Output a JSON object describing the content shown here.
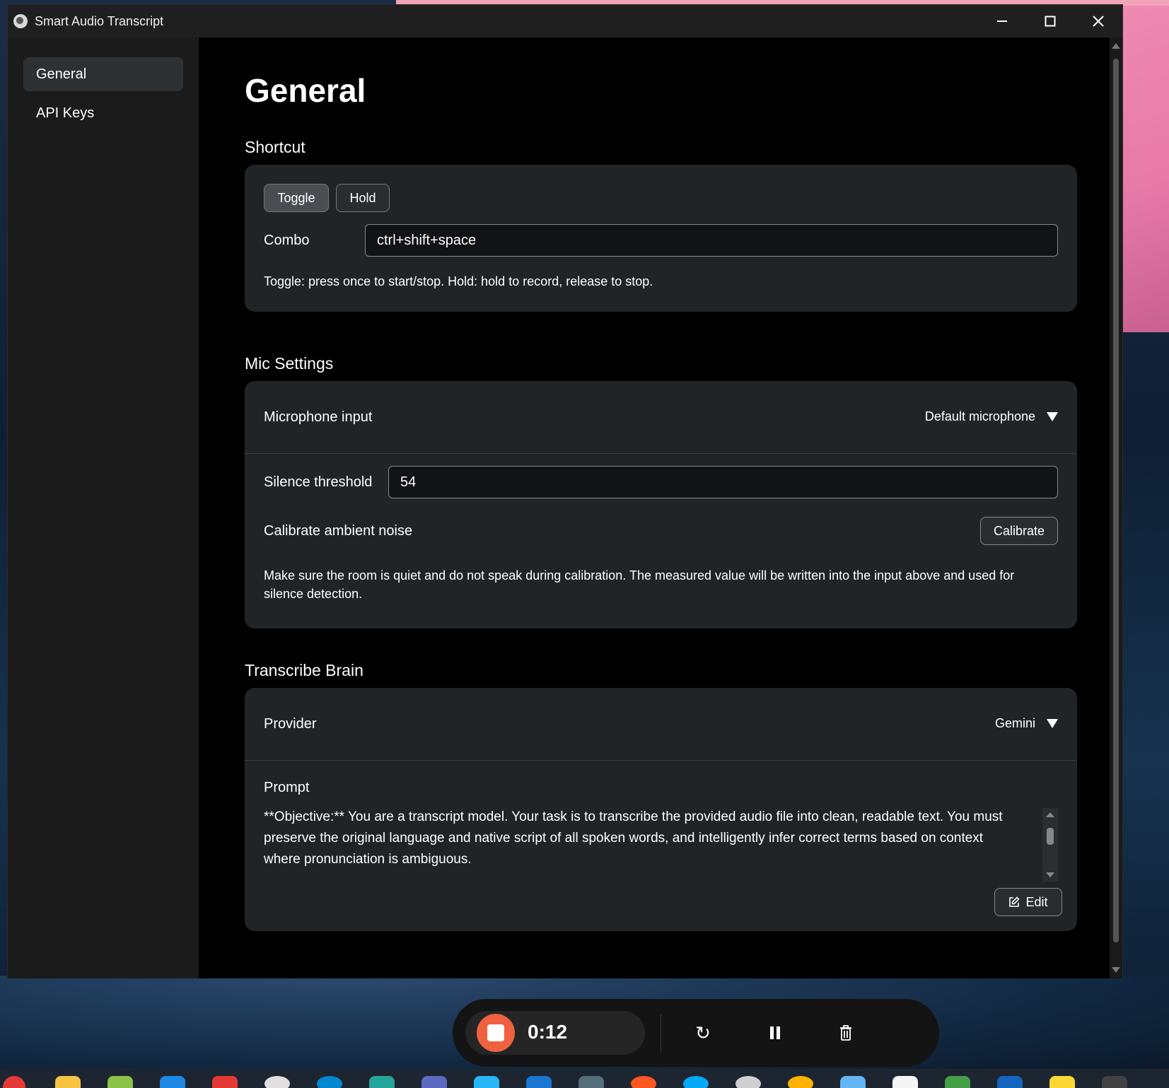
{
  "window": {
    "title": "Smart Audio Transcript"
  },
  "sidebar": {
    "items": [
      {
        "label": "General",
        "active": true
      },
      {
        "label": "API Keys",
        "active": false
      }
    ]
  },
  "page": {
    "title": "General"
  },
  "shortcut": {
    "section_title": "Shortcut",
    "modes": [
      "Toggle",
      "Hold"
    ],
    "selected_mode": "Toggle",
    "combo_label": "Combo",
    "combo_value": "ctrl+shift+space",
    "help": "Toggle: press once to start/stop. Hold: hold to record, release to stop."
  },
  "mic": {
    "section_title": "Mic Settings",
    "input_label": "Microphone input",
    "input_value": "Default microphone",
    "threshold_label": "Silence threshold",
    "threshold_value": "54",
    "calibrate_label": "Calibrate ambient noise",
    "calibrate_button": "Calibrate",
    "help": "Make sure the room is quiet and do not speak during calibration. The measured value will be written into the input above and used for silence detection."
  },
  "brain": {
    "section_title": "Transcribe Brain",
    "provider_label": "Provider",
    "provider_value": "Gemini",
    "prompt_label": "Prompt",
    "prompt_text": "**Objective:** You are a transcript model. Your task is to transcribe the provided audio file into clean, readable text. You must preserve the original language and native script of all spoken words, and intelligently infer correct terms based on context where pronunciation is ambiguous.",
    "edit_button": "Edit"
  },
  "recorder": {
    "elapsed": "0:12"
  },
  "colors": {
    "record_accent": "#f0613f",
    "card_bg": "#212426",
    "sidebar_bg": "#1b1b1b"
  },
  "taskbar_icons": [
    "chrome-icon",
    "folder-icon",
    "notes-icon",
    "app-icon",
    "camera-icon",
    "discord-icon",
    "edge-icon",
    "terminal-icon",
    "calendar-icon",
    "app3-icon",
    "vscode-icon",
    "tools-icon",
    "git-icon",
    "browser-icon",
    "obs-icon",
    "weather-icon",
    "mail-icon",
    "maps-icon",
    "whatsapp-icon",
    "teams-icon",
    "paint-icon",
    "misc-icon"
  ]
}
